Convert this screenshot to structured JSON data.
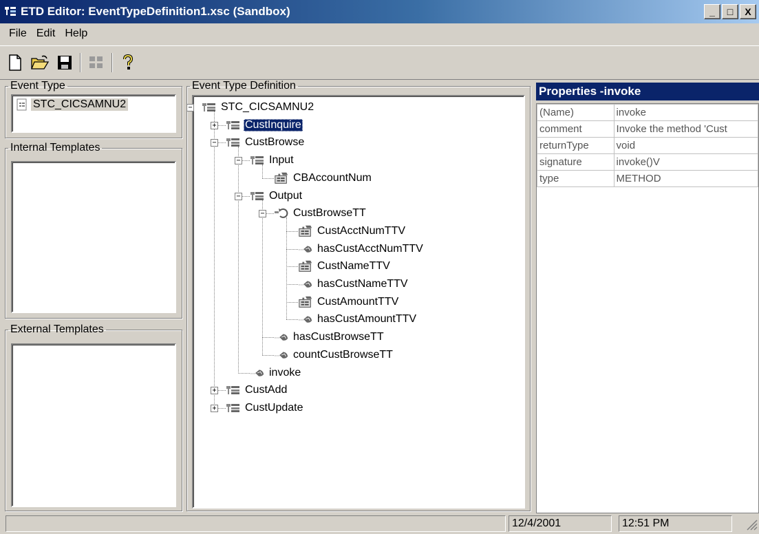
{
  "window": {
    "title": "ETD Editor: EventTypeDefinition1.xsc (Sandbox)",
    "minimize_label": "_",
    "maximize_label": "□",
    "close_label": "X"
  },
  "menu": [
    "File",
    "Edit",
    "Help"
  ],
  "toolbar": {
    "icons": [
      "new-file-icon",
      "open-folder-icon",
      "save-disk-icon",
      "grid-icon",
      "help-question-icon"
    ]
  },
  "event_type": {
    "legend": "Event Type",
    "item": "STC_CICSAMNU2"
  },
  "internal_templates": {
    "legend": "Internal Templates"
  },
  "external_templates": {
    "legend": "External Templates"
  },
  "etd": {
    "legend": "Event Type Definition",
    "nodes": [
      {
        "label": "STC_CICSAMNU2",
        "icon": "class-icon",
        "toggle": "−"
      },
      {
        "label": "CustInquire",
        "icon": "class-icon",
        "toggle": "+",
        "selected": true
      },
      {
        "label": "CustBrowse",
        "icon": "class-icon",
        "toggle": "−"
      },
      {
        "label": "Input",
        "icon": "class-icon",
        "toggle": "−"
      },
      {
        "label": "CBAccountNum",
        "icon": "field-icon"
      },
      {
        "label": "Output",
        "icon": "class-icon",
        "toggle": "−"
      },
      {
        "label": "CustBrowseTT",
        "icon": "repeating-class-icon",
        "toggle": "−"
      },
      {
        "label": "CustAcctNumTTV",
        "icon": "field-icon"
      },
      {
        "label": "hasCustAcctNumTTV",
        "icon": "method-icon"
      },
      {
        "label": "CustNameTTV",
        "icon": "field-icon"
      },
      {
        "label": "hasCustNameTTV",
        "icon": "method-icon"
      },
      {
        "label": "CustAmountTTV",
        "icon": "field-icon"
      },
      {
        "label": "hasCustAmountTTV",
        "icon": "method-icon"
      },
      {
        "label": "hasCustBrowseTT",
        "icon": "method-icon"
      },
      {
        "label": "countCustBrowseTT",
        "icon": "method-icon"
      },
      {
        "label": "invoke",
        "icon": "method-icon"
      },
      {
        "label": "CustAdd",
        "icon": "class-icon",
        "toggle": "+"
      },
      {
        "label": "CustUpdate",
        "icon": "class-icon",
        "toggle": "+"
      }
    ]
  },
  "properties": {
    "title": "Properties -invoke",
    "rows": [
      {
        "name": "(Name)",
        "value": "invoke"
      },
      {
        "name": "comment",
        "value": "Invoke the method 'Cust"
      },
      {
        "name": "returnType",
        "value": "void"
      },
      {
        "name": "signature",
        "value": "invoke()V"
      },
      {
        "name": "type",
        "value": "METHOD"
      }
    ]
  },
  "status": {
    "date": "12/4/2001",
    "time": "12:51 PM"
  },
  "colors": {
    "title_bar": "#0a246a",
    "selection": "#0a246a",
    "face": "#d4d0c8"
  }
}
